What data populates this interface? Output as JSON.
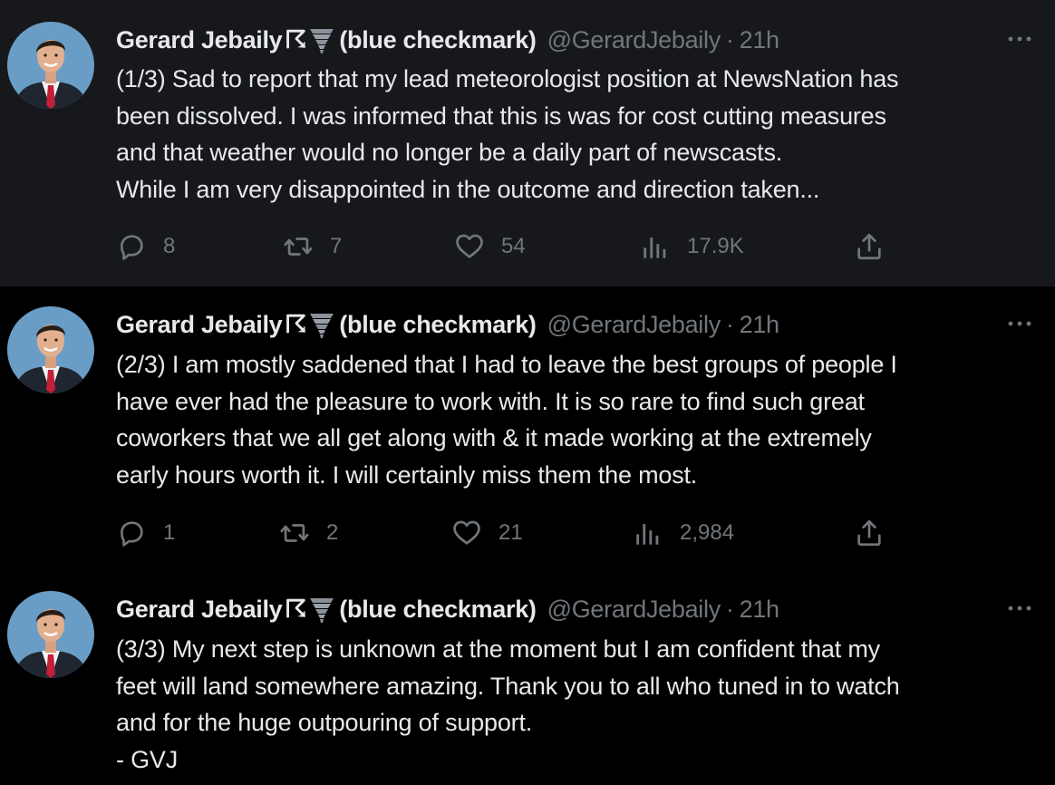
{
  "colors": {
    "background": "#000000",
    "highlighted_tweet_background": "#16181c",
    "primary_text": "#e7e9ea",
    "secondary_text": "#71767b",
    "thread_line": "#3a3e43"
  },
  "tweets": [
    {
      "author": {
        "display_name": "Gerard Jebaily",
        "badge_glyph": "☈",
        "emoji": "tornado",
        "name_suffix": "(blue checkmark)",
        "handle": "@GerardJebaily",
        "separator": "·",
        "time": "21h"
      },
      "text_lines": [
        "(1/3) Sad to report that my lead meteorologist position at NewsNation has",
        "been dissolved. I was informed that this is was for cost cutting measures",
        "and that weather would no longer be a daily part of newscasts.",
        "While I am very disappointed in the outcome and direction taken..."
      ],
      "actions": {
        "reply": {
          "icon": "reply-icon",
          "count": "8"
        },
        "retweet": {
          "icon": "retweet-icon",
          "count": "7"
        },
        "like": {
          "icon": "heart-icon",
          "count": "54"
        },
        "views": {
          "icon": "views-icon",
          "count": "17.9K"
        },
        "share": {
          "icon": "share-icon"
        }
      },
      "more_icon": "more-icon"
    },
    {
      "author": {
        "display_name": "Gerard Jebaily",
        "badge_glyph": "☈",
        "emoji": "tornado",
        "name_suffix": "(blue checkmark)",
        "handle": "@GerardJebaily",
        "separator": "·",
        "time": "21h"
      },
      "text_lines": [
        "(2/3) I am mostly saddened that I had to leave the best groups of people I",
        "have ever had the pleasure to work with. It is so rare to find such great",
        "coworkers that we all get along with & it made working at the extremely",
        "early hours worth it. I will certainly miss them the most."
      ],
      "actions": {
        "reply": {
          "icon": "reply-icon",
          "count": "1"
        },
        "retweet": {
          "icon": "retweet-icon",
          "count": "2"
        },
        "like": {
          "icon": "heart-icon",
          "count": "21"
        },
        "views": {
          "icon": "views-icon",
          "count": "2,984"
        },
        "share": {
          "icon": "share-icon"
        }
      },
      "more_icon": "more-icon"
    },
    {
      "author": {
        "display_name": "Gerard Jebaily",
        "badge_glyph": "☈",
        "emoji": "tornado",
        "name_suffix": "(blue checkmark)",
        "handle": "@GerardJebaily",
        "separator": "·",
        "time": "21h"
      },
      "text_lines": [
        "(3/3) My next step is unknown at the moment but I am confident that my",
        "feet will land somewhere amazing. Thank you to all who tuned in to watch",
        "and for the huge outpouring of support.",
        "- GVJ"
      ],
      "more_icon": "more-icon"
    }
  ]
}
